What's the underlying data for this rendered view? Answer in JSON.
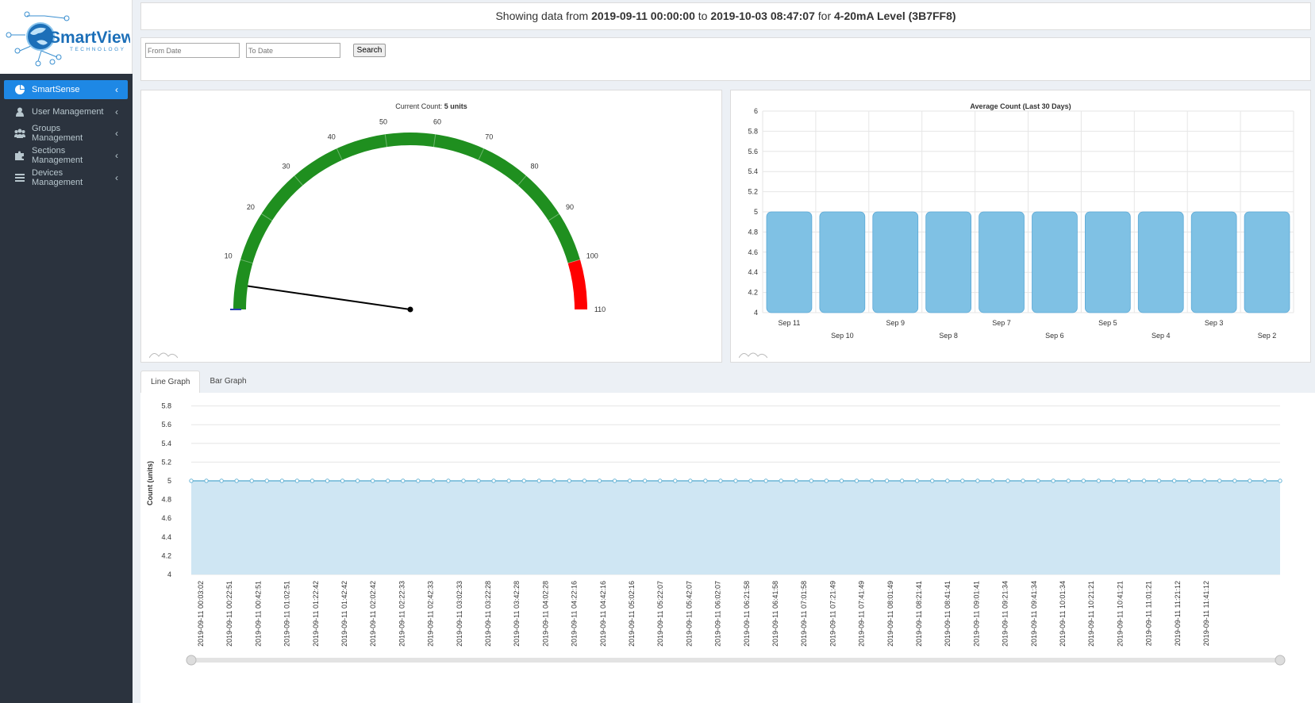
{
  "brand": {
    "name": "SmartView",
    "tagline": "TECHNOLOGY"
  },
  "sidebar": {
    "items": [
      {
        "label": "SmartSense",
        "icon": "pie-chart-icon",
        "active": true
      },
      {
        "label": "User Management",
        "icon": "user-icon"
      },
      {
        "label": "Groups Management",
        "icon": "users-icon"
      },
      {
        "label": "Sections Management",
        "icon": "puzzle-icon"
      },
      {
        "label": "Devices Management",
        "icon": "list-icon"
      }
    ]
  },
  "header": {
    "prefix": "Showing data from",
    "from": "2019-09-11 00:00:00",
    "to_word": "to",
    "to": "2019-10-03 08:47:07",
    "for_word": "for",
    "device": "4-20mA Level (3B7FF8)"
  },
  "filter": {
    "from_placeholder": "From Date",
    "to_placeholder": "To Date",
    "search_label": "Search"
  },
  "tabs": {
    "line": "Line Graph",
    "bar": "Bar Graph"
  },
  "colors": {
    "accent": "#1e88e5",
    "gauge_green": "#1f8f1f",
    "gauge_red": "#ff0000",
    "bar_fill": "#7fc1e4",
    "line": "#6ab5d6",
    "area": "#cfe6f3"
  },
  "chart_data": [
    {
      "type": "gauge",
      "title_prefix": "Current Count:",
      "title_value": "5 units",
      "value": 5,
      "min": 0,
      "max": 110,
      "ticks": [
        10,
        20,
        30,
        40,
        50,
        60,
        70,
        80,
        90,
        100,
        110
      ],
      "bands": [
        {
          "from": 0,
          "to": 100,
          "color": "#1f8f1f"
        },
        {
          "from": 100,
          "to": 110,
          "color": "#ff0000"
        }
      ]
    },
    {
      "type": "bar",
      "title": "Average Count (Last 30 Days)",
      "categories": [
        "Sep 11",
        "Sep 10",
        "Sep 9",
        "Sep 8",
        "Sep 7",
        "Sep 6",
        "Sep 5",
        "Sep 4",
        "Sep 3",
        "Sep 2"
      ],
      "values": [
        5,
        5,
        5,
        5,
        5,
        5,
        5,
        5,
        5,
        5
      ],
      "ylim": [
        4,
        6
      ],
      "yticks": [
        "4",
        "4.2",
        "4.4",
        "4.6",
        "4.8",
        "5",
        "5.2",
        "5.4",
        "5.6",
        "5.8",
        "6"
      ],
      "grid": true
    },
    {
      "type": "area",
      "ylabel": "Count (units)",
      "ylim": [
        4,
        6
      ],
      "yticks": [
        "4",
        "4.2",
        "4.4",
        "4.6",
        "4.8",
        "5",
        "5.2",
        "5.4",
        "5.6",
        "5.8",
        "6"
      ],
      "x_labels": [
        "2019-09-11 00:03:02",
        "2019-09-11 00:22:51",
        "2019-09-11 00:42:51",
        "2019-09-11 01:02:51",
        "2019-09-11 01:22:42",
        "2019-09-11 01:42:42",
        "2019-09-11 02:02:42",
        "2019-09-11 02:22:33",
        "2019-09-11 02:42:33",
        "2019-09-11 03:02:33",
        "2019-09-11 03:22:28",
        "2019-09-11 03:42:28",
        "2019-09-11 04:02:28",
        "2019-09-11 04:22:16",
        "2019-09-11 04:42:16",
        "2019-09-11 05:02:16",
        "2019-09-11 05:22:07",
        "2019-09-11 05:42:07",
        "2019-09-11 06:02:07",
        "2019-09-11 06:21:58",
        "2019-09-11 06:41:58",
        "2019-09-11 07:01:58",
        "2019-09-11 07:21:49",
        "2019-09-11 07:41:49",
        "2019-09-11 08:01:49",
        "2019-09-11 08:21:41",
        "2019-09-11 08:41:41",
        "2019-09-11 09:01:41",
        "2019-09-11 09:21:34",
        "2019-09-11 09:41:34",
        "2019-09-11 10:01:34",
        "2019-09-11 10:21:21",
        "2019-09-11 10:41:21",
        "2019-09-11 11:01:21",
        "2019-09-11 11:21:12",
        "2019-09-11 11:41:12"
      ],
      "point_count": 73,
      "value": 5
    }
  ]
}
